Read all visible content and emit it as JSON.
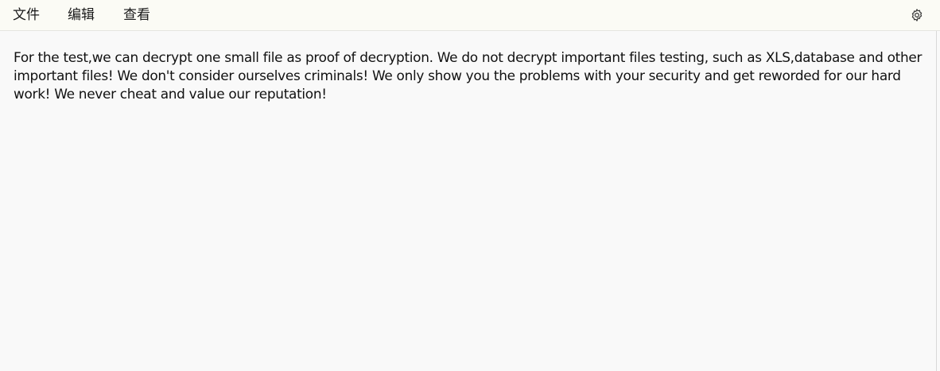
{
  "menubar": {
    "file_label": "文件",
    "edit_label": "编辑",
    "view_label": "查看",
    "settings_icon": "gear-icon"
  },
  "editor": {
    "content": "For the test,we can decrypt one small file as proof of decryption. We do not decrypt important files testing, such as XLS,database and other important files! We don't consider ourselves criminals! We only show you the problems with your security and get reworded for our hard work! We never cheat and value our reputation!"
  }
}
